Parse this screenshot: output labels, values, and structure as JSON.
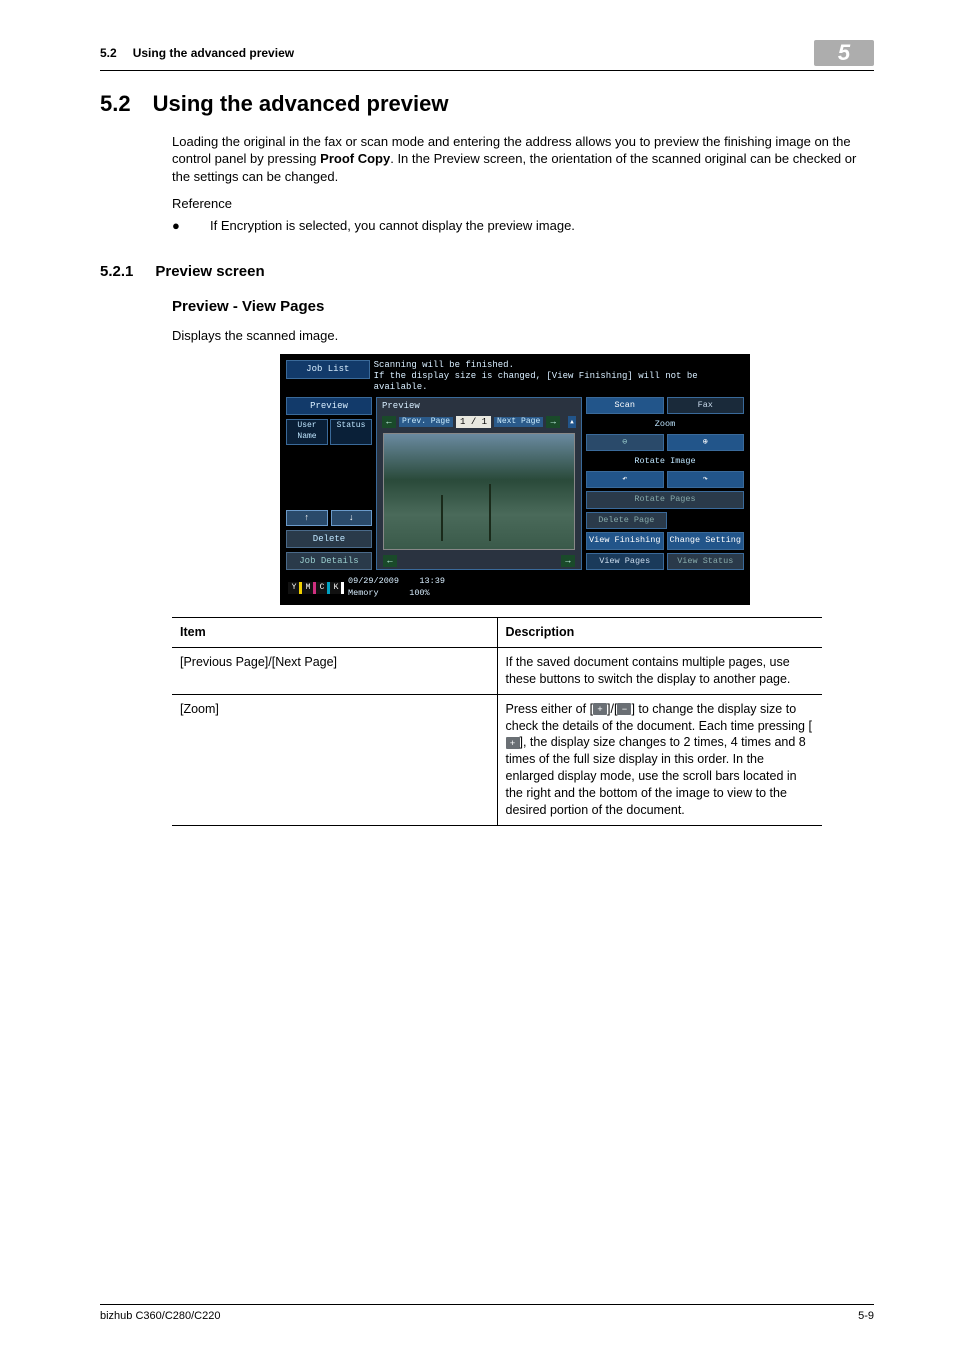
{
  "running_head": {
    "num": "5.2",
    "title": "Using the advanced preview",
    "chapter": "5"
  },
  "h2": {
    "num": "5.2",
    "title": "Using the advanced preview"
  },
  "intro": "Loading the original in the fax or scan mode and entering the address allows you to preview the finishing image on the control panel by pressing Proof Copy. In the Preview screen, the orientation of the scanned original can be checked or the settings can be changed.",
  "intro_pre": "Loading the original in the fax or scan mode and entering the address allows you to preview the finishing image on the control panel by pressing ",
  "intro_bold": "Proof Copy",
  "intro_post": ". In the Preview screen, the orientation of the scanned original can be checked or the settings can be changed.",
  "reference_label": "Reference",
  "bullet": "If Encryption is selected, you cannot display the preview image.",
  "h3": {
    "num": "5.2.1",
    "title": "Preview screen"
  },
  "h4": "Preview - View Pages",
  "sub_p": "Displays the scanned image.",
  "mfp": {
    "job_list": "Job List",
    "msg1": "Scanning will be finished.",
    "msg2": "If the display size is changed, [View Finishing] will not be available.",
    "preview": "Preview",
    "status": "Status",
    "user": "User Name",
    "delete": "Delete",
    "job_details": "Job Details",
    "center_head": "Preview",
    "prev_page": "Prev. Page",
    "next_page": "Next Page",
    "page_disp": "1 /     1",
    "scan": "Scan",
    "fax": "Fax",
    "zoom": "Zoom",
    "rotate_image": "Rotate Image",
    "rotate_pages": "Rotate Pages",
    "delete_page": "Delete Page",
    "view_finishing": "View Finishing",
    "change_setting": "Change Setting",
    "view_pages": "View Pages",
    "view_status": "View Status",
    "date": "09/29/2009",
    "time": "13:39",
    "memory_label": "Memory",
    "memory_val": "100%",
    "toner": {
      "y": "Y",
      "m": "M",
      "c": "C",
      "k": "K"
    }
  },
  "table": {
    "h_item": "Item",
    "h_desc": "Description",
    "rows": [
      {
        "item": "[Previous Page]/[Next Page]",
        "desc": "If the saved document contains multiple pages, use these buttons to switch the display to another page."
      },
      {
        "item": "[Zoom]",
        "desc_a": "Press either of [",
        "desc_b": "]/[",
        "desc_c": "] to change the display size to check the details of the document. Each time pressing [",
        "desc_d": "], the display size changes to 2 times, 4 times and 8 times of the full size display in this order. In the enlarged display mode, use the scroll bars located in the right and the bottom of the image to view to the desired portion of the document."
      }
    ]
  },
  "footer": {
    "model": "bizhub C360/C280/C220",
    "page": "5-9"
  }
}
